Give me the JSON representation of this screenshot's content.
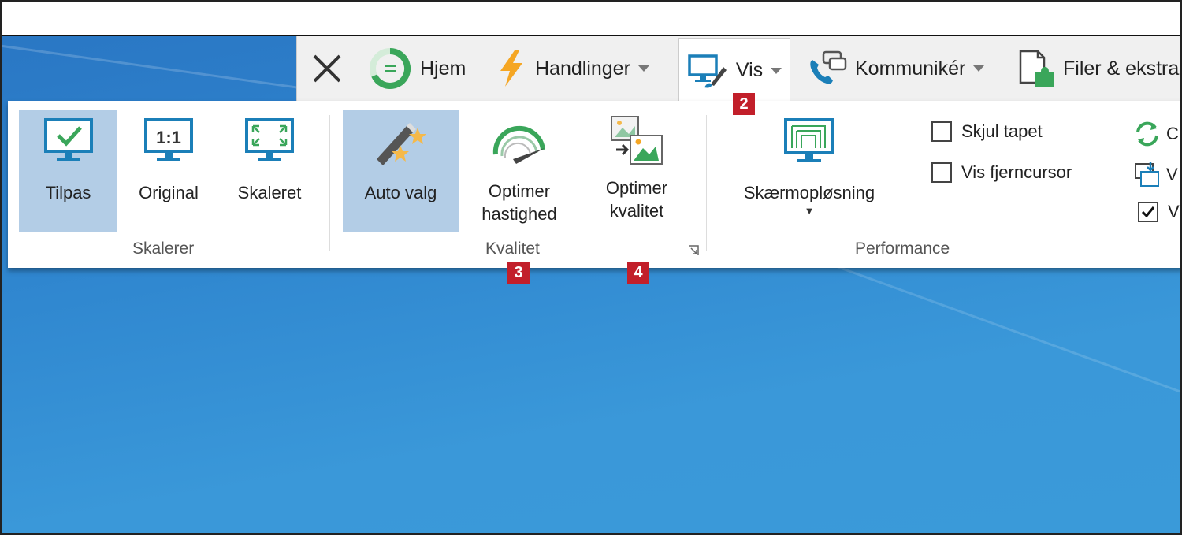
{
  "tabs": [
    {
      "id": "close",
      "label": ""
    },
    {
      "id": "hjem",
      "label": "Hjem"
    },
    {
      "id": "handlinger",
      "label": "Handlinger"
    },
    {
      "id": "vis",
      "label": "Vis"
    },
    {
      "id": "kommuniker",
      "label": "Kommunikér"
    },
    {
      "id": "filer",
      "label": "Filer & ekstra"
    }
  ],
  "ribbon": {
    "skalerer": {
      "label": "Skalerer",
      "buttons": [
        {
          "label": "Tilpas",
          "icon": "monitor-check-icon",
          "selected": true
        },
        {
          "label": "Original",
          "icon": "monitor-1to1-icon",
          "selected": false
        },
        {
          "label": "Skaleret",
          "icon": "monitor-expand-icon",
          "selected": false
        }
      ]
    },
    "kvalitet": {
      "label": "Kvalitet",
      "buttons": [
        {
          "label": "Auto valg",
          "icon": "magic-wand-icon",
          "selected": true
        },
        {
          "label1": "Optimer",
          "label2": "hastighed",
          "icon": "speedometer-icon"
        },
        {
          "label1": "Optimer",
          "label2": "kvalitet",
          "icon": "image-quality-icon"
        }
      ]
    },
    "performance": {
      "label": "Performance",
      "resolution_label": "Skærmopløsning",
      "checkboxes": [
        {
          "label": "Skjul tapet",
          "checked": false
        },
        {
          "label": "Vis fjerncursor",
          "checked": false
        }
      ]
    },
    "cut_off": {
      "line1": "C",
      "line2": "V",
      "line3": "V"
    }
  },
  "markers": [
    "2",
    "3",
    "4"
  ],
  "colors": {
    "selected_bg": "#b3cde6",
    "icon_blue": "#1b7fb8",
    "icon_green": "#3aa65a",
    "marker_red": "#c21f2a",
    "bolt_orange": "#f5a623"
  }
}
